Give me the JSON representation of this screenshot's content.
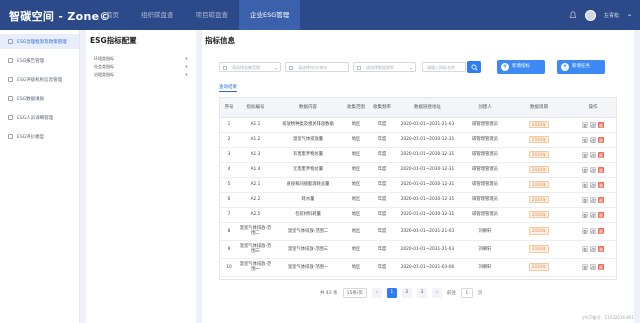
{
  "app": {
    "logo": "智碳空间 - Zone©"
  },
  "nav": {
    "tabs": [
      {
        "label": "首页",
        "active": false
      },
      {
        "label": "组织碳盘查",
        "active": false
      },
      {
        "label": "项目碳盘查",
        "active": false
      },
      {
        "label": "企业ESG管理",
        "active": true
      }
    ]
  },
  "header_right": {
    "user": "左青松"
  },
  "sidebar": {
    "items": [
      {
        "label": "ESG治理框架及政策管理",
        "active": true
      },
      {
        "label": "ESG报告管理",
        "active": false
      },
      {
        "label": "ESG评级机构信息管理",
        "active": false
      },
      {
        "label": "ESG数据填报",
        "active": false
      },
      {
        "label": "ESG人员详细管理",
        "active": false
      },
      {
        "label": "ESG评价模型",
        "active": false
      }
    ]
  },
  "tree": {
    "title": "ESG指标配置",
    "items": [
      {
        "label": "环境类指标",
        "sign": "+"
      },
      {
        "label": "社会类指标",
        "sign": "+"
      },
      {
        "label": "治理类指标",
        "sign": "+"
      }
    ]
  },
  "main": {
    "title": "指标信息",
    "filters": [
      "请选择收集范围",
      "请选择年份/地址",
      "请选择数据频率",
      "请输入指标名称"
    ],
    "search_icon": "search-icon",
    "add_indicator": "新增指标",
    "add_task": "新增任务",
    "sub_tab": "查询结果",
    "columns": [
      "序号",
      "指标编号",
      "数据内容",
      "收集范围",
      "收集频率",
      "数据链接地址",
      "创建人",
      "数据周期",
      "操作"
    ],
    "rows": [
      {
        "no": "1",
        "code": "A1.1",
        "content": "排放物种类及相关排放数据",
        "scope": "地区",
        "freq": "年度",
        "link": "2020-01-01~2031-21-03",
        "creator": "碳管理管理员",
        "cycle": "2020年"
      },
      {
        "no": "2",
        "code": "A1.2",
        "content": "温室气体排放量",
        "scope": "地区",
        "freq": "年度",
        "link": "2020-01-01~2030-12-31",
        "creator": "碳管理管理员",
        "cycle": "2020年"
      },
      {
        "no": "3",
        "code": "A1.3",
        "content": "有害废弃物总量",
        "scope": "地区",
        "freq": "年度",
        "link": "2020-01-01~2030-12-31",
        "creator": "碳管理管理员",
        "cycle": "2020年"
      },
      {
        "no": "4",
        "code": "A1.4",
        "content": "无害废弃物总量",
        "scope": "地区",
        "freq": "年度",
        "link": "2020-01-01~2030-12-31",
        "creator": "碳管理管理员",
        "cycle": "2020年"
      },
      {
        "no": "5",
        "code": "A2.1",
        "content": "直接和间接能源耗总量",
        "scope": "地区",
        "freq": "年度",
        "link": "2020-01-01~2030-12-31",
        "creator": "碳管理管理员",
        "cycle": "2020年"
      },
      {
        "no": "6",
        "code": "A2.2",
        "content": "耗水量",
        "scope": "地区",
        "freq": "年度",
        "link": "2020-01-01~2030-12-31",
        "creator": "碳管理管理员",
        "cycle": "2020年"
      },
      {
        "no": "7",
        "code": "A2.5",
        "content": "包装材料耗量",
        "scope": "地区",
        "freq": "年度",
        "link": "2020-01-01~2030-12-31",
        "creator": "碳管理管理员",
        "cycle": "2020年"
      },
      {
        "no": "8",
        "code": "温室气体排放-范围二",
        "content": "温室气体排放-范围二",
        "scope": "地区",
        "freq": "年度",
        "link": "2020-01-01~2031-21-03",
        "creator": "刘朝轩",
        "cycle": "2020年"
      },
      {
        "no": "9",
        "code": "温室气体排放-范围三",
        "content": "温室气体排放-范围三",
        "scope": "地区",
        "freq": "年度",
        "link": "2020-01-01~2031-21-03",
        "creator": "刘朝轩",
        "cycle": "2020年"
      },
      {
        "no": "10",
        "code": "温室气体排放-范围一",
        "content": "温室气体排放-范围一",
        "scope": "地区",
        "freq": "年度",
        "link": "2020-01-01~2031-03-06",
        "creator": "刘朝轩",
        "cycle": "2020年"
      }
    ],
    "ops": [
      "查",
      "改",
      "删"
    ]
  },
  "pager": {
    "total": "共 43 条",
    "size": "15条/页",
    "prev": "‹",
    "pages": [
      "1",
      "2",
      "3"
    ],
    "current": "1",
    "next": "›",
    "goto_label": "前往",
    "goto_value": "1",
    "page_unit": "页"
  },
  "footer": {
    "text": "沪ICP备号：11432016-801"
  }
}
